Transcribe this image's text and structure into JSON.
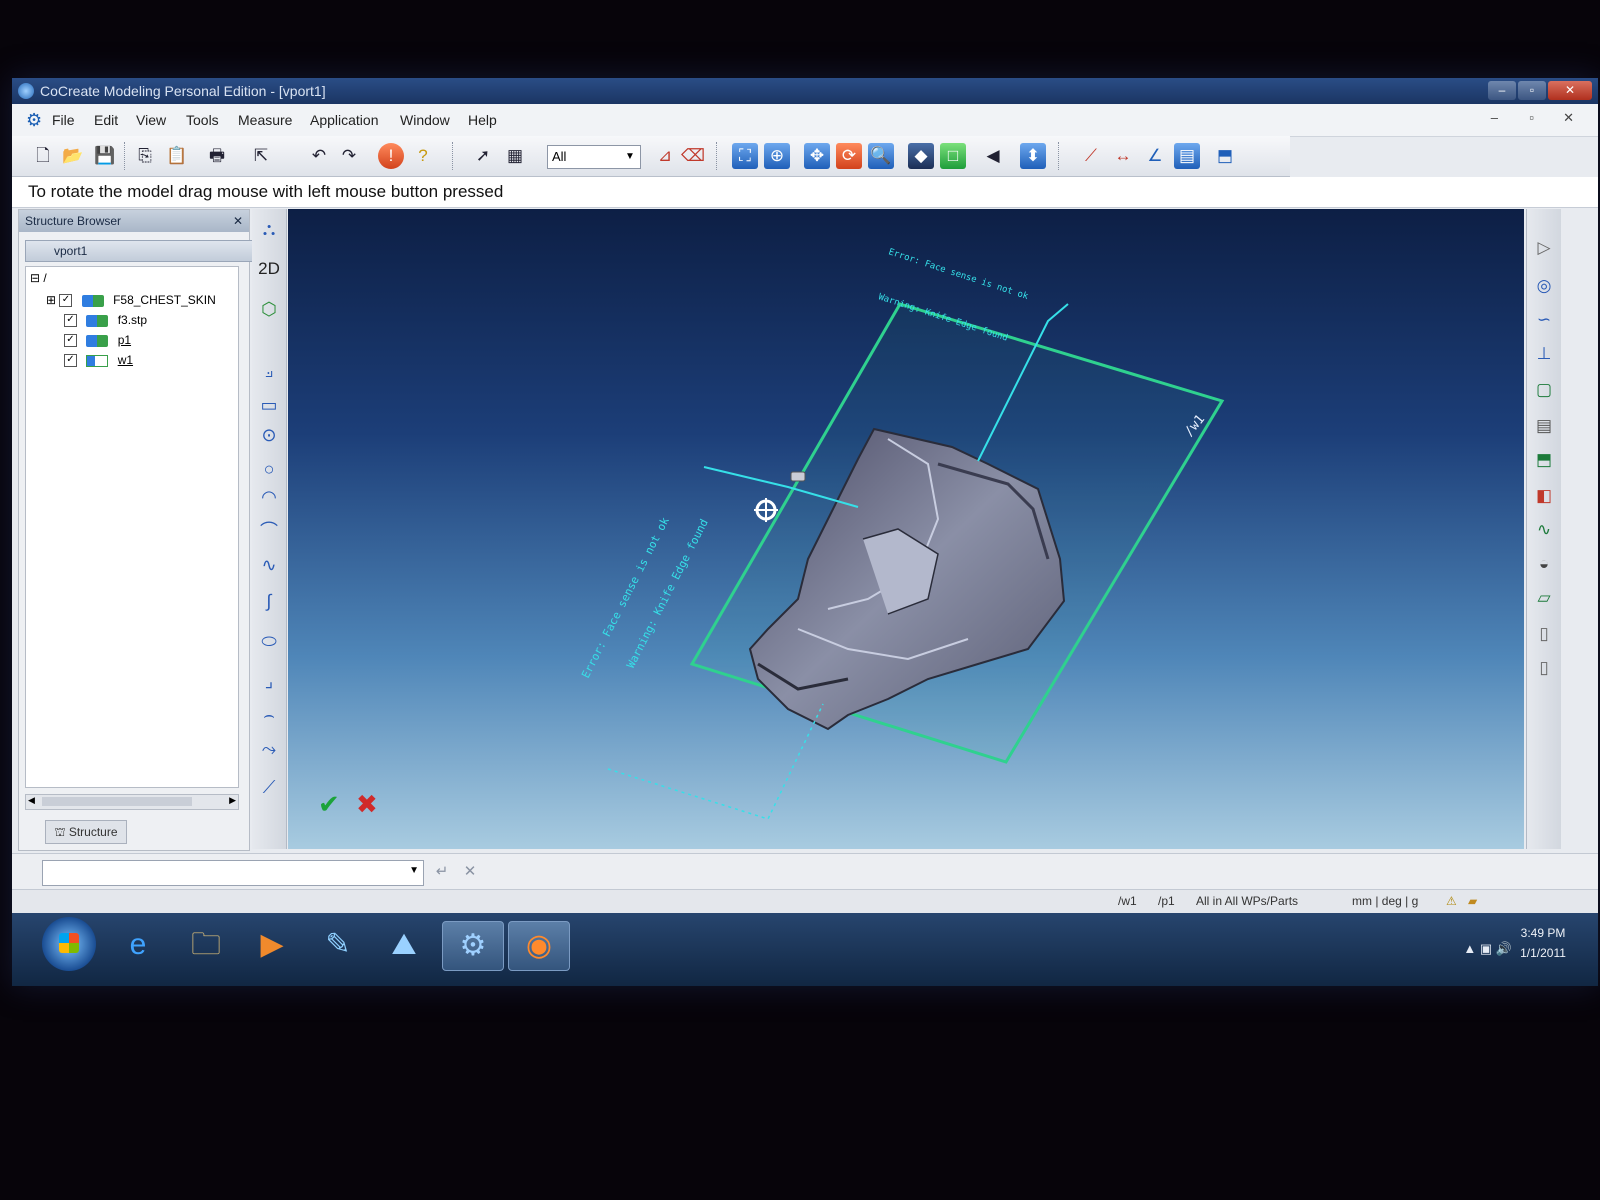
{
  "window": {
    "title": "CoCreate Modeling Personal Edition - [vport1]",
    "controls": [
      "–",
      "▫",
      "✕"
    ]
  },
  "menu": {
    "items": [
      "File",
      "Edit",
      "View",
      "Tools",
      "Measure",
      "Application",
      "Window",
      "Help"
    ],
    "mdi_controls": [
      "–",
      "▫",
      "✕"
    ]
  },
  "toolbar": {
    "select_filter": "All"
  },
  "prompt": "To rotate the model drag mouse with left mouse button pressed",
  "structure_browser": {
    "title": "Structure Browser",
    "close": "✕",
    "viewport_selector": "vport1",
    "root": "/",
    "nodes": [
      {
        "label": "F58_CHEST_SKIN",
        "checked": true,
        "type": "assembly"
      },
      {
        "label": "f3.stp",
        "checked": true,
        "type": "part"
      },
      {
        "label": "p1",
        "checked": true,
        "type": "part"
      },
      {
        "label": "w1",
        "checked": true,
        "type": "workplane"
      }
    ],
    "tab": "Structure"
  },
  "left_strip": {
    "mode_2d": "2D"
  },
  "viewport": {
    "workplane_label": "/w1",
    "annotations": [
      "Error: Face sense is not ok",
      "Warning: Knife Edge found",
      "Error: Face sense is not ok",
      "Warning: Knife Edge found"
    ],
    "colors": {
      "workplane": "#2fd18f",
      "annotation": "#36e0e8"
    }
  },
  "command": {
    "input_value": "",
    "enter_icon": "↵",
    "clear_icon": "✕"
  },
  "status": {
    "workplane": "/w1",
    "part": "/p1",
    "scope": "All in All WPs/Parts",
    "units": "mm | deg | g"
  },
  "taskbar": {
    "apps": [
      "start-orb",
      "internet-explorer",
      "file-explorer",
      "media-player",
      "paint",
      "cocreate",
      "settings",
      "firefox"
    ],
    "time": "3:49 PM",
    "date": "1/1/2011"
  }
}
